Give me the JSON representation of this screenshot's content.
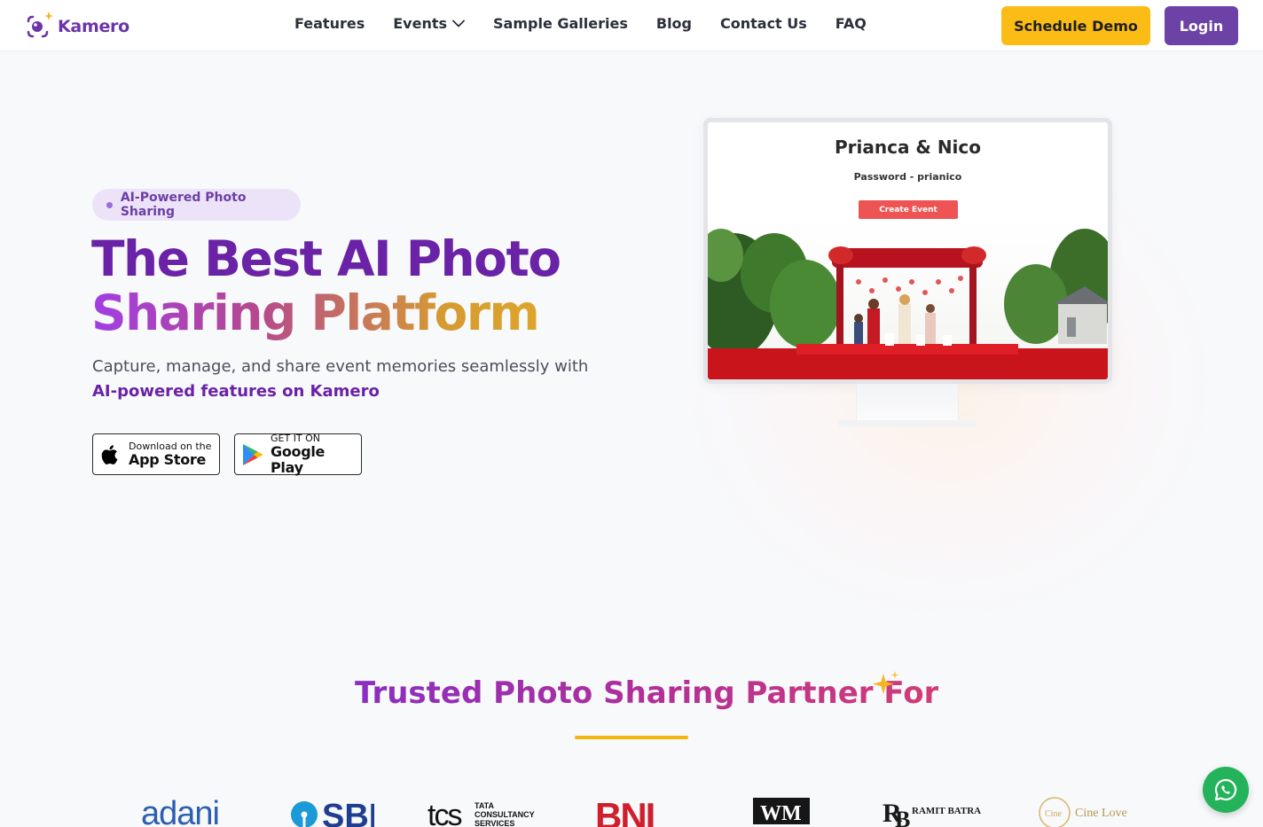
{
  "brand": {
    "name": "Kamero",
    "color": "#6b35a8"
  },
  "nav": {
    "links": [
      "Features",
      "Events",
      "Sample Galleries",
      "Blog",
      "Contact Us",
      "FAQ"
    ],
    "schedule_demo": "Schedule Demo",
    "login": "Login"
  },
  "hero": {
    "badge": "AI-Powered Photo Sharing",
    "title_line1": "The Best AI Photo",
    "title_line2": "Sharing Platform",
    "subtitle": "Capture, manage, and share event memories seamlessly with",
    "subtitle_highlight": "AI-powered features on Kamero",
    "app_store_small": "Download on the",
    "app_store_big": "App Store",
    "play_small": "GET IT ON",
    "play_big": "Google Play"
  },
  "monitor": {
    "event_title": "Prianca & Nico",
    "password": "Password - prianico",
    "create_event": "Create Event"
  },
  "trusted": {
    "title": "Trusted Photo Sharing Partner For",
    "logos": [
      "adani",
      "SBI",
      "tcs",
      "BNI",
      "WM",
      "RAMIT BATRA",
      "Cine Love"
    ],
    "logo_texts": {
      "tcs_sub": [
        "TATA",
        "CONSULTANCY",
        "SERVICES"
      ],
      "rb_sub": "RAMIT BATRA",
      "cine": "Cine Love"
    }
  },
  "colors": {
    "accent_purple": "#6a22a6",
    "demo_yellow": "#fbbc15",
    "login_purple": "#6c42a6",
    "whatsapp_green": "#24b35a"
  }
}
